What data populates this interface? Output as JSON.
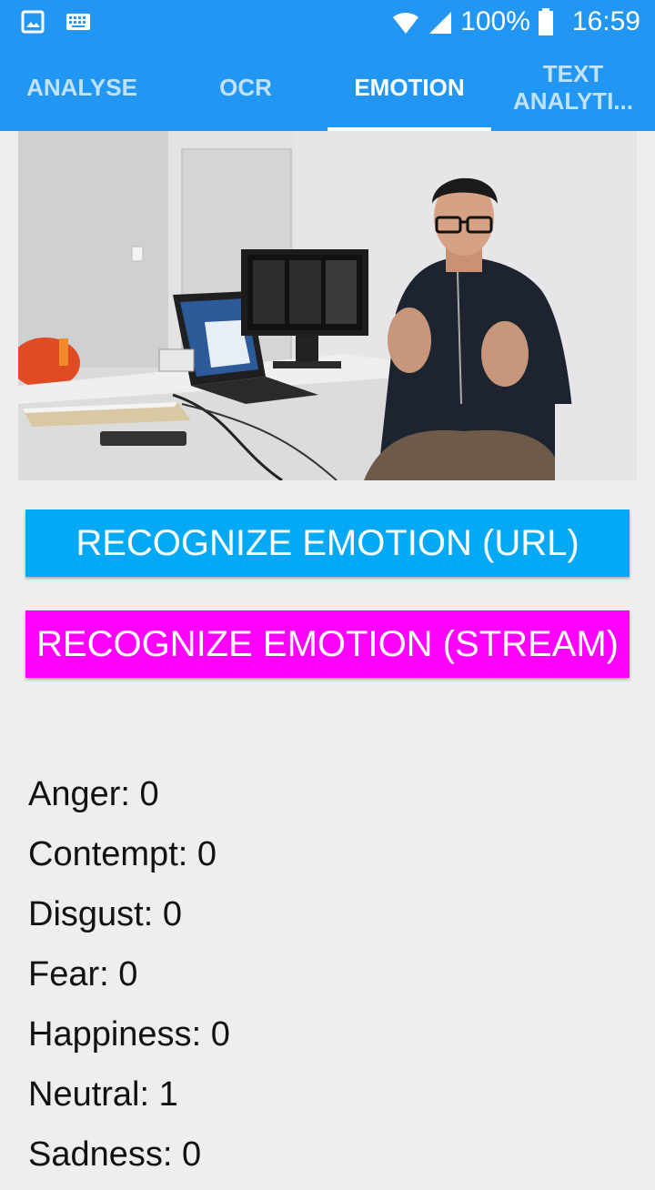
{
  "status_bar": {
    "battery_text": "100%",
    "time": "16:59",
    "icons": [
      "gallery-icon",
      "keyboard-icon",
      "wifi-icon",
      "signal-icon",
      "battery-icon"
    ]
  },
  "tabs": [
    {
      "label": "ANALYSE",
      "active": false
    },
    {
      "label": "OCR",
      "active": false
    },
    {
      "label": "EMOTION",
      "active": true
    },
    {
      "label_line1": "TEXT",
      "label_line2": "ANALYTI...",
      "active": false
    }
  ],
  "buttons": {
    "url_label": "RECOGNIZE EMOTION (URL)",
    "stream_label": "RECOGNIZE EMOTION (STREAM)"
  },
  "results": [
    {
      "label": "Anger",
      "value": "0"
    },
    {
      "label": "Contempt",
      "value": "0"
    },
    {
      "label": "Disgust",
      "value": "0"
    },
    {
      "label": "Fear",
      "value": "0"
    },
    {
      "label": "Happiness",
      "value": "0"
    },
    {
      "label": "Neutral",
      "value": "1"
    },
    {
      "label": "Sadness",
      "value": "0"
    }
  ],
  "colors": {
    "primary": "#2196f3",
    "url_button": "#03a9f4",
    "stream_button": "#ff00ff",
    "background": "#eeeeee"
  }
}
